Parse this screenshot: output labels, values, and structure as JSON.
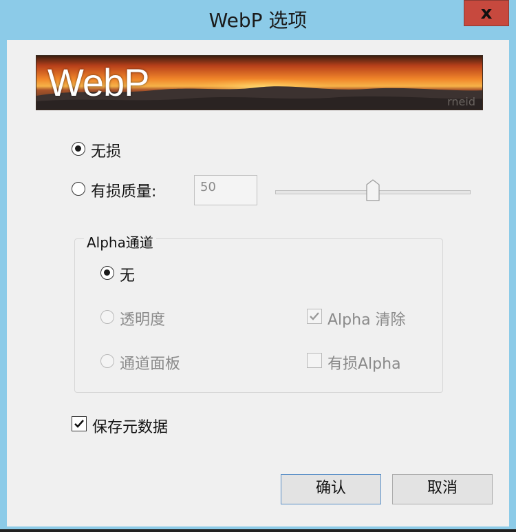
{
  "window": {
    "title": "WebP 选项",
    "close_label": "x"
  },
  "banner": {
    "logo_text": "WebP",
    "credit": "rneid"
  },
  "compression": {
    "lossless_label": "无损",
    "lossy_label": "有损质量:",
    "selected": "lossless",
    "quality_value": "50",
    "quality_slider_fraction": 0.5
  },
  "alpha_channel": {
    "legend": "Alpha通道",
    "none_label": "无",
    "transparency_label": "透明度",
    "channel_panel_label": "通道面板",
    "selected": "none",
    "alpha_clear_label": "Alpha 清除",
    "alpha_clear_checked": true,
    "lossy_alpha_label": "有损Alpha",
    "lossy_alpha_checked": false
  },
  "save_metadata": {
    "label": "保存元数据",
    "checked": true
  },
  "buttons": {
    "ok_label": "确认",
    "cancel_label": "取消"
  },
  "colors": {
    "titlebar": "#8ccbe8",
    "close_button": "#c7493e",
    "dialog_bg": "#f0f0f0"
  }
}
